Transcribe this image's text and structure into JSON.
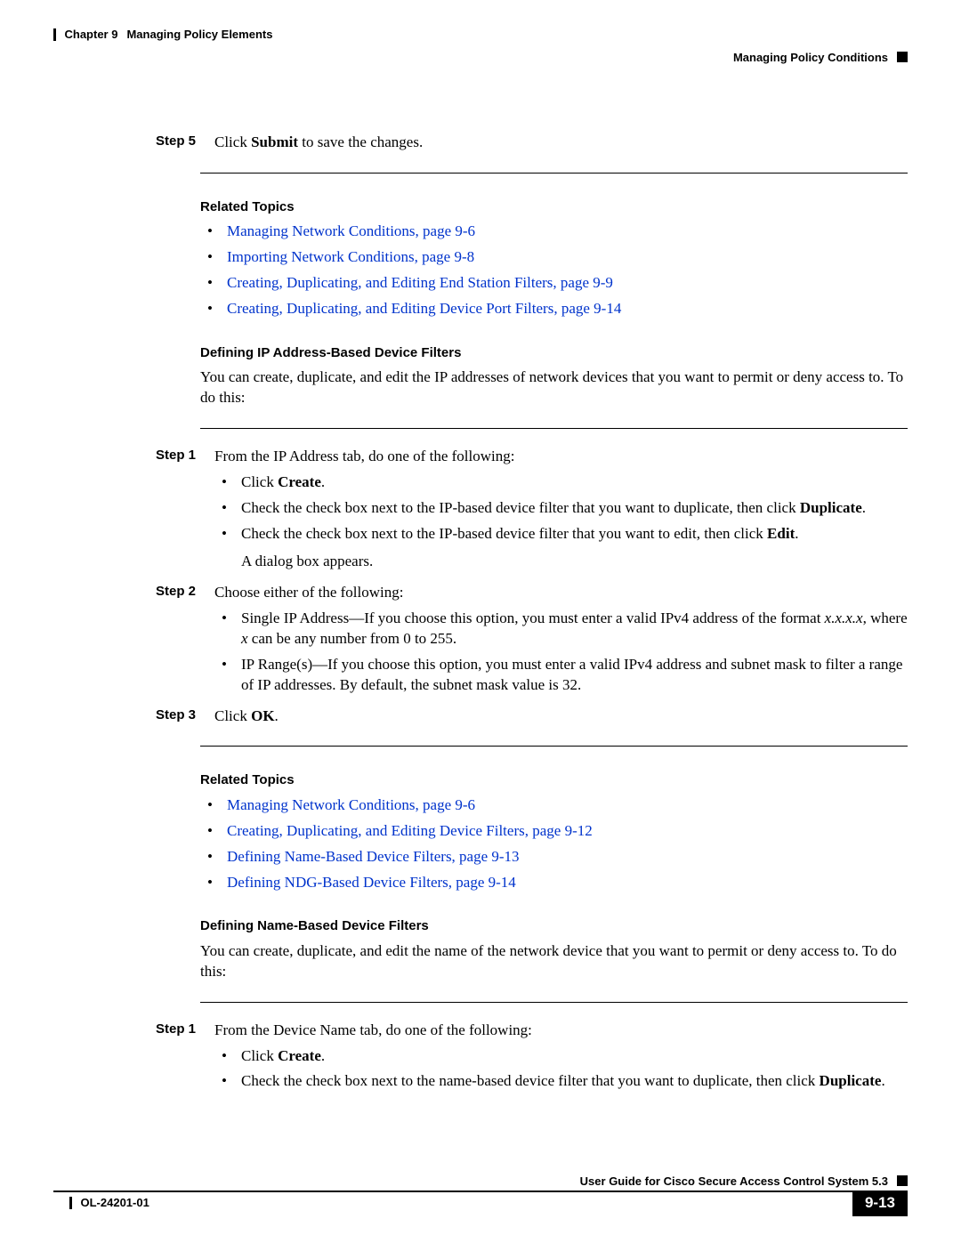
{
  "header": {
    "chapter_label": "Chapter 9",
    "chapter_title": "Managing Policy Elements",
    "section_title": "Managing Policy Conditions"
  },
  "step5": {
    "label": "Step 5",
    "pre": "Click ",
    "bold": "Submit",
    "post": " to save the changes."
  },
  "related_topics_1": {
    "heading": "Related Topics",
    "items": [
      "Managing Network Conditions, page 9-6",
      "Importing Network Conditions, page 9-8",
      "Creating, Duplicating, and Editing End Station Filters, page 9-9",
      "Creating, Duplicating, and Editing Device Port Filters, page 9-14"
    ]
  },
  "ip_section": {
    "heading": "Defining IP Address-Based Device Filters",
    "intro": "You can create, duplicate, and edit the IP addresses of network devices that you want to permit or deny access to. To do this:"
  },
  "ip_step1": {
    "label": "Step 1",
    "text": "From the IP Address tab, do one of the following:",
    "b1_pre": "Click ",
    "b1_bold": "Create",
    "b1_post": ".",
    "b2_pre": "Check the check box next to the IP-based device filter that you want to duplicate, then click ",
    "b2_bold": "Duplicate",
    "b2_post": ".",
    "b3_pre": "Check the check box next to the IP-based device filter that you want to edit, then click ",
    "b3_bold": "Edit",
    "b3_post": ".",
    "after": "A dialog box appears."
  },
  "ip_step2": {
    "label": "Step 2",
    "text": "Choose either of the following:",
    "b1_a": "Single IP Address—If you choose this option, you must enter a valid IPv4 address of the format ",
    "b1_i1": "x.x.x.x",
    "b1_b": ", where ",
    "b1_i2": "x",
    "b1_c": " can be any number from 0 to 255.",
    "b2": "IP Range(s)—If you choose this option, you must enter a valid IPv4 address and subnet mask to filter a range of IP addresses. By default, the subnet mask value is 32."
  },
  "ip_step3": {
    "label": "Step 3",
    "pre": "Click ",
    "bold": "OK",
    "post": "."
  },
  "related_topics_2": {
    "heading": "Related Topics",
    "items": [
      "Managing Network Conditions, page 9-6",
      "Creating, Duplicating, and Editing Device Filters, page 9-12",
      "Defining Name-Based Device Filters, page 9-13",
      "Defining NDG-Based Device Filters, page 9-14"
    ]
  },
  "name_section": {
    "heading": "Defining Name-Based Device Filters",
    "intro": "You can create, duplicate, and edit the name of the network device that you want to permit or deny access to. To do this:"
  },
  "name_step1": {
    "label": "Step 1",
    "text": "From the Device Name tab, do one of the following:",
    "b1_pre": "Click ",
    "b1_bold": "Create",
    "b1_post": ".",
    "b2_pre": "Check the check box next to the name-based device filter that you want to duplicate, then click ",
    "b2_bold": "Duplicate",
    "b2_post": "."
  },
  "footer": {
    "guide": "User Guide for Cisco Secure Access Control System 5.3",
    "doc_id": "OL-24201-01",
    "page_num": "9-13"
  }
}
